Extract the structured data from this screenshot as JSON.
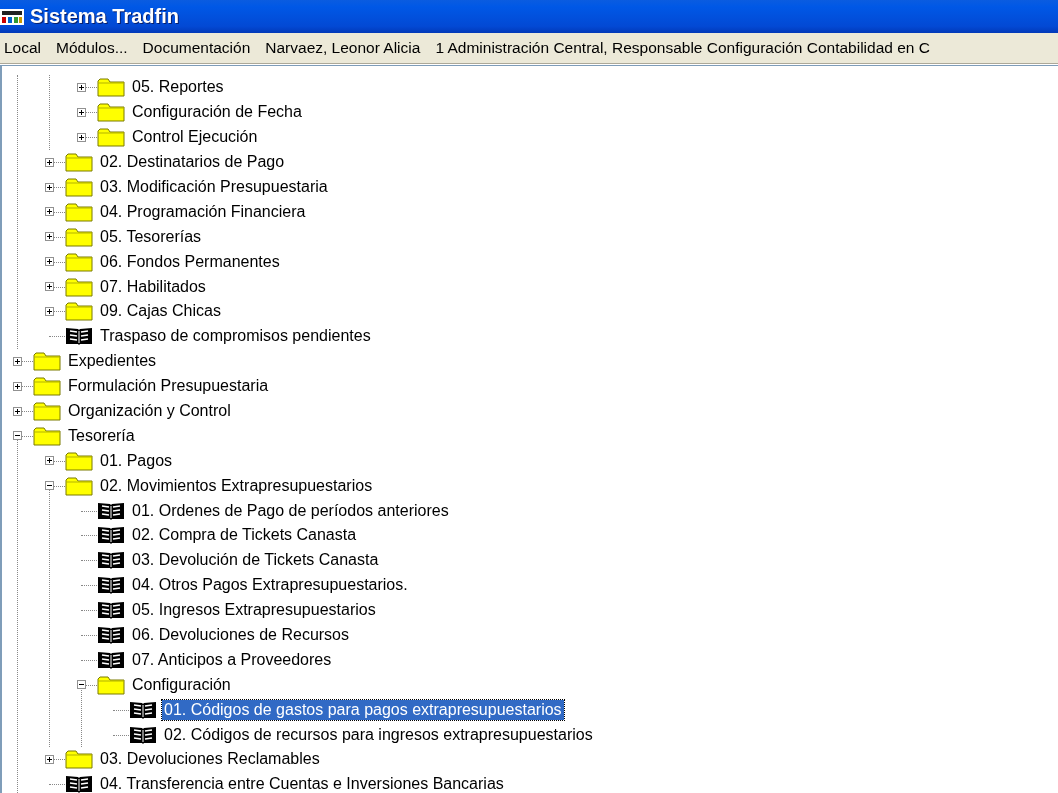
{
  "window": {
    "title": "Sistema Tradfin"
  },
  "menu": [
    {
      "label": "Local"
    },
    {
      "label": "Módulos..."
    },
    {
      "label": "Documentación"
    },
    {
      "label": "Narvaez, Leonor Alicia"
    },
    {
      "label": "1 Administración Central, Responsable Configuración Contabilidad en C"
    }
  ],
  "tree": [
    {
      "children": [
        {
          "children": [
            {
              "label": "05. Reportes",
              "kind": "folder",
              "expanded": false,
              "selected": false
            },
            {
              "label": "Configuración de Fecha",
              "kind": "folder",
              "expanded": false,
              "selected": false
            },
            {
              "label": "Control Ejecución",
              "kind": "folder",
              "expanded": false,
              "selected": false
            }
          ]
        },
        {
          "label": "02. Destinatarios de Pago",
          "kind": "folder",
          "expanded": false,
          "selected": false
        },
        {
          "label": "03. Modificación Presupuestaria",
          "kind": "folder",
          "expanded": false,
          "selected": false
        },
        {
          "label": "04. Programación Financiera",
          "kind": "folder",
          "expanded": false,
          "selected": false
        },
        {
          "label": "05. Tesorerías",
          "kind": "folder",
          "expanded": false,
          "selected": false
        },
        {
          "label": "06. Fondos Permanentes",
          "kind": "folder",
          "expanded": false,
          "selected": false
        },
        {
          "label": "07. Habilitados",
          "kind": "folder",
          "expanded": false,
          "selected": false
        },
        {
          "label": "09. Cajas Chicas",
          "kind": "folder",
          "expanded": false,
          "selected": false
        },
        {
          "label": "Traspaso de compromisos pendientes",
          "kind": "item",
          "selected": false
        }
      ]
    },
    {
      "label": "Expedientes",
      "kind": "folder",
      "expanded": false,
      "selected": false
    },
    {
      "label": "Formulación Presupuestaria",
      "kind": "folder",
      "expanded": false,
      "selected": false
    },
    {
      "label": "Organización y Control",
      "kind": "folder",
      "expanded": false,
      "selected": false
    },
    {
      "label": "Tesorería",
      "kind": "folder",
      "expanded": true,
      "selected": false,
      "children": [
        {
          "label": "01. Pagos",
          "kind": "folder",
          "expanded": false,
          "selected": false
        },
        {
          "label": "02. Movimientos Extrapresupuestarios",
          "kind": "folder",
          "expanded": true,
          "selected": false,
          "children": [
            {
              "label": "01. Ordenes de Pago de períodos anteriores",
              "kind": "item",
              "selected": false
            },
            {
              "label": "02.  Compra de Tickets Canasta",
              "kind": "item",
              "selected": false
            },
            {
              "label": "03.  Devolución de Tickets Canasta",
              "kind": "item",
              "selected": false
            },
            {
              "label": "04.  Otros Pagos Extrapresupuestarios.",
              "kind": "item",
              "selected": false
            },
            {
              "label": "05.  Ingresos Extrapresupuestarios",
              "kind": "item",
              "selected": false
            },
            {
              "label": "06.  Devoluciones de Recursos",
              "kind": "item",
              "selected": false
            },
            {
              "label": "07. Anticipos a Proveedores",
              "kind": "item",
              "selected": false
            },
            {
              "label": "Configuración",
              "kind": "folder",
              "expanded": true,
              "selected": false,
              "children": [
                {
                  "label": "01.  Códigos de gastos para pagos extrapresupuestarios",
                  "kind": "item",
                  "selected": true
                },
                {
                  "label": "02.  Códigos de recursos para ingresos extrapresupuestarios",
                  "kind": "item",
                  "selected": false
                }
              ]
            }
          ]
        },
        {
          "label": "03. Devoluciones Reclamables",
          "kind": "folder",
          "expanded": false,
          "selected": false
        },
        {
          "label": "04.  Transferencia entre Cuentas e Inversiones Bancarias",
          "kind": "item",
          "selected": false
        }
      ]
    }
  ]
}
